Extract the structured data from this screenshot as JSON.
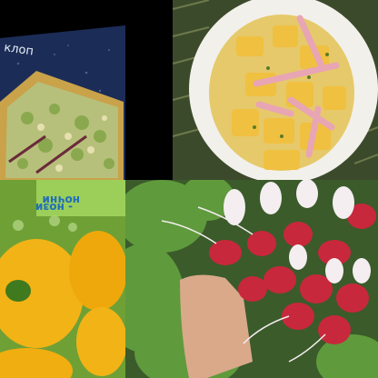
{
  "tiles": [
    {
      "subject": "seed packet with bread and herbs",
      "caption": "клоп"
    },
    {
      "subject": "potato salad with ham on white plate"
    },
    {
      "subject": "yellow pattypan squash seed packet",
      "caption_lines": [
        "ночни",
        "- нози"
      ]
    },
    {
      "subject": "hand holding bunch of red and white radishes"
    }
  ],
  "colors": {
    "packet_blue": "#1b2c57",
    "bread": "#c9a24a",
    "potato": "#f0c040",
    "ham": "#e8a5b4",
    "plate": "#f2f0ea",
    "squash": "#f2b316",
    "leaf_green": "#4f8f2f",
    "radish_red": "#c8283c"
  }
}
